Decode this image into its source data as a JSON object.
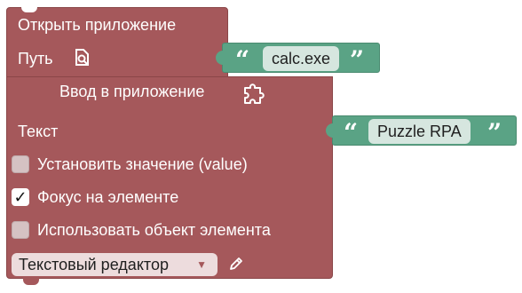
{
  "open_app_block": {
    "title": "Открыть приложение",
    "path_label": "Путь",
    "path_value": "calc.exe",
    "color": "#a5585b"
  },
  "input_block": {
    "title": "Ввод в приложение",
    "text_label": "Текст",
    "text_value": "Puzzle RPA",
    "options": [
      {
        "label": "Установить значение (value)",
        "checked": false,
        "check_mark": ""
      },
      {
        "label": "Фокус на элементе",
        "checked": true,
        "check_mark": "✓"
      },
      {
        "label": "Использовать объект элемента",
        "checked": false,
        "check_mark": ""
      }
    ],
    "editor_dropdown": "Текстовый редактор",
    "color": "#a5585b"
  },
  "string_block": {
    "open_quote": "“",
    "close_quote": "”",
    "color": "#5aa385"
  },
  "icons": {
    "path_search": "file-search-icon",
    "puzzle": "puzzle-icon",
    "dropdown_arrow": "triangle-down-icon",
    "edit": "pencil-icon"
  }
}
